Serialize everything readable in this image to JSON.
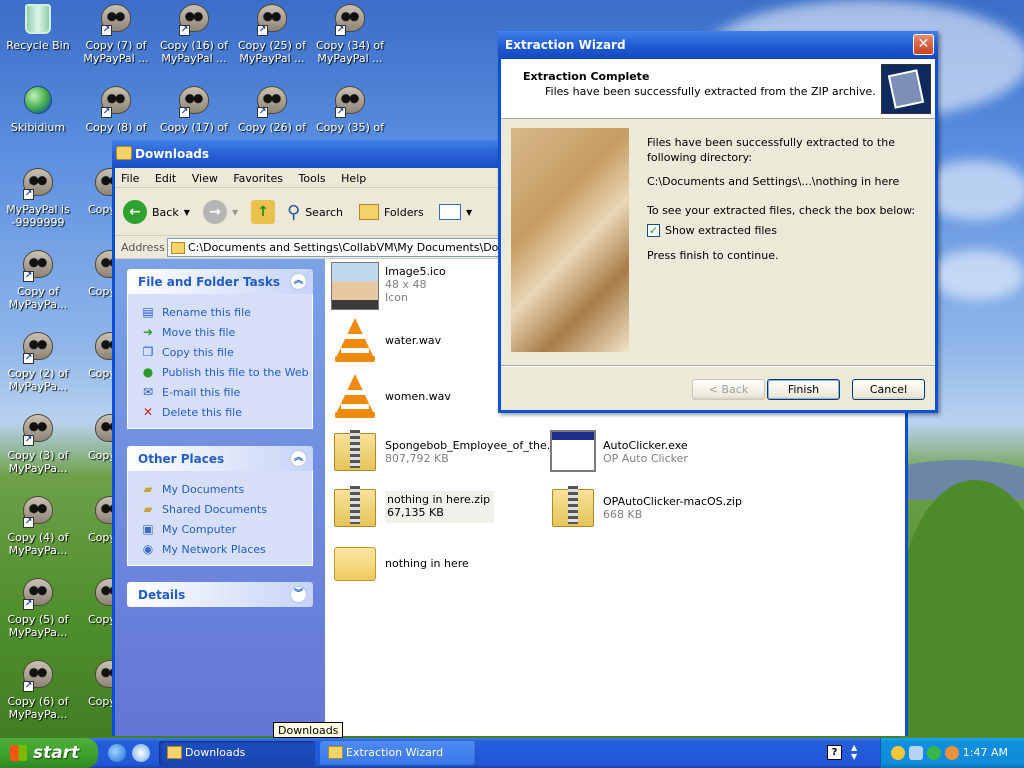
{
  "desktop": {
    "icons": [
      {
        "label": "Recycle Bin",
        "icon": "recycle-bin-icon"
      },
      {
        "label": "Skibidium",
        "icon": "globe-icon"
      },
      {
        "label": "MyPayPal is -9999999",
        "icon": "raccoon-icon"
      },
      {
        "label": "Copy of MyPayPa...",
        "icon": "raccoon-icon"
      },
      {
        "label": "Copy (2) of MyPayPa...",
        "icon": "raccoon-icon"
      },
      {
        "label": "Copy (3) of MyPayPa...",
        "icon": "raccoon-icon"
      },
      {
        "label": "Copy (4) of MyPayPa...",
        "icon": "raccoon-icon"
      },
      {
        "label": "Copy (5) of MyPayPa...",
        "icon": "raccoon-icon"
      },
      {
        "label": "Copy (6) of MyPayPa...",
        "icon": "raccoon-icon"
      },
      {
        "label": "Copy (7) of MyPayPal ...",
        "icon": "raccoon-icon"
      },
      {
        "label": "Copy (8) of",
        "icon": "raccoon-icon"
      },
      {
        "label": "Copy (16) of MyPayPal ...",
        "icon": "raccoon-icon"
      },
      {
        "label": "Copy (17) of",
        "icon": "raccoon-icon"
      },
      {
        "label": "Copy (25) of MyPayPal ...",
        "icon": "raccoon-icon"
      },
      {
        "label": "Copy (26) of",
        "icon": "raccoon-icon"
      },
      {
        "label": "Copy (34) of MyPayPal ...",
        "icon": "raccoon-icon"
      },
      {
        "label": "Copy (35) of",
        "icon": "raccoon-icon"
      },
      {
        "label": "Copy",
        "icon": "raccoon-icon"
      },
      {
        "label": "Copy",
        "icon": "raccoon-icon"
      },
      {
        "label": "Copy",
        "icon": "raccoon-icon"
      },
      {
        "label": "Copy",
        "icon": "raccoon-icon"
      },
      {
        "label": "Copy",
        "icon": "raccoon-icon"
      },
      {
        "label": "Copy",
        "icon": "raccoon-icon"
      },
      {
        "label": "Copy",
        "icon": "raccoon-icon"
      }
    ]
  },
  "explorer": {
    "title": "Downloads",
    "menu": [
      "File",
      "Edit",
      "View",
      "Favorites",
      "Tools",
      "Help"
    ],
    "toolbar": {
      "back": "Back",
      "search": "Search",
      "folders": "Folders"
    },
    "address_label": "Address",
    "address_value": "C:\\Documents and Settings\\CollabVM\\My Documents\\Downloads",
    "file_tasks": {
      "title": "File and Folder Tasks",
      "items": [
        {
          "label": "Rename this file",
          "icon": "rename-icon"
        },
        {
          "label": "Move this file",
          "icon": "move-icon"
        },
        {
          "label": "Copy this file",
          "icon": "copy-icon"
        },
        {
          "label": "Publish this file to the Web",
          "icon": "web-publish-icon"
        },
        {
          "label": "E-mail this file",
          "icon": "email-icon"
        },
        {
          "label": "Delete this file",
          "icon": "delete-icon"
        }
      ]
    },
    "other_places": {
      "title": "Other Places",
      "items": [
        {
          "label": "My Documents",
          "icon": "my-documents-icon"
        },
        {
          "label": "Shared Documents",
          "icon": "shared-documents-icon"
        },
        {
          "label": "My Computer",
          "icon": "my-computer-icon"
        },
        {
          "label": "My Network Places",
          "icon": "network-places-icon"
        }
      ]
    },
    "details": {
      "title": "Details"
    },
    "files": [
      {
        "name": "Image5.ico",
        "line2": "48 x 48",
        "line3": "Icon",
        "icon": "image-icon"
      },
      {
        "name": "water.wav",
        "line2": "",
        "line3": "",
        "icon": "vlc-icon"
      },
      {
        "name": "women.wav",
        "line2": "",
        "line3": "",
        "icon": "vlc-icon"
      },
      {
        "name": "Spongebob_Employee_of_the...",
        "line2": "807,792 KB",
        "line3": "",
        "icon": "zip-folder-icon"
      },
      {
        "name": "AutoClicker.exe",
        "line2": "OP Auto Clicker",
        "line3": "",
        "icon": "exe-icon"
      },
      {
        "name": "nothing in here.zip",
        "line2": "67,135 KB",
        "line3": "",
        "icon": "zip-folder-icon"
      },
      {
        "name": "OPAutoClicker-macOS.zip",
        "line2": "668 KB",
        "line3": "",
        "icon": "zip-folder-icon"
      },
      {
        "name": "nothing in here",
        "line2": "",
        "line3": "",
        "icon": "folder-icon"
      }
    ]
  },
  "wizard": {
    "title": "Extraction Wizard",
    "header_title": "Extraction Complete",
    "header_subtitle": "Files have been successfully extracted from the ZIP archive.",
    "body_line1": "Files have been successfully extracted to the following directory:",
    "directory": "C:\\Documents and Settings\\...\\nothing in here",
    "check_prompt": "To see your extracted files, check the box below:",
    "checkbox_label": "Show extracted files",
    "checkbox_checked": true,
    "finish_prompt": "Press finish to continue.",
    "buttons": {
      "back": "< Back",
      "finish": "Finish",
      "cancel": "Cancel"
    }
  },
  "tooltip": "Downloads",
  "taskbar": {
    "start": "start",
    "tasks": [
      {
        "label": "Downloads",
        "active": true
      },
      {
        "label": "Extraction Wizard",
        "active": false
      }
    ],
    "clock": "1:47 AM"
  }
}
